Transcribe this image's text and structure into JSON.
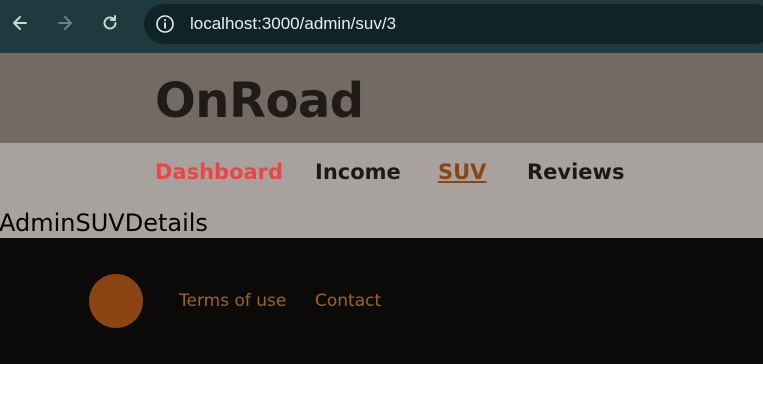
{
  "browser": {
    "url": "localhost:3000/admin/suv/3",
    "icons": {
      "back": "arrow-left-icon",
      "forward": "arrow-right-icon",
      "reload": "reload-icon",
      "info": "info-icon"
    }
  },
  "header": {
    "brand": "OnRoad"
  },
  "nav": {
    "items": [
      {
        "label": "Dashboard",
        "color": "#ef4444"
      },
      {
        "label": "Income",
        "color": "#1c1917"
      },
      {
        "label": "SUV",
        "color": "#8b4513",
        "active": true
      },
      {
        "label": "Reviews",
        "color": "#1c1917"
      }
    ]
  },
  "main": {
    "heading": "AdminSUVDetails"
  },
  "footer": {
    "logo_color": "#8b4513",
    "links": [
      {
        "label": "Terms of use"
      },
      {
        "label": "Contact"
      }
    ]
  },
  "colors": {
    "browser_bar": "#1f3a3f",
    "header_bg": "#736a64",
    "nav_bg": "#a8a29e",
    "footer_bg": "#0c0a09",
    "accent": "#8b4513"
  }
}
